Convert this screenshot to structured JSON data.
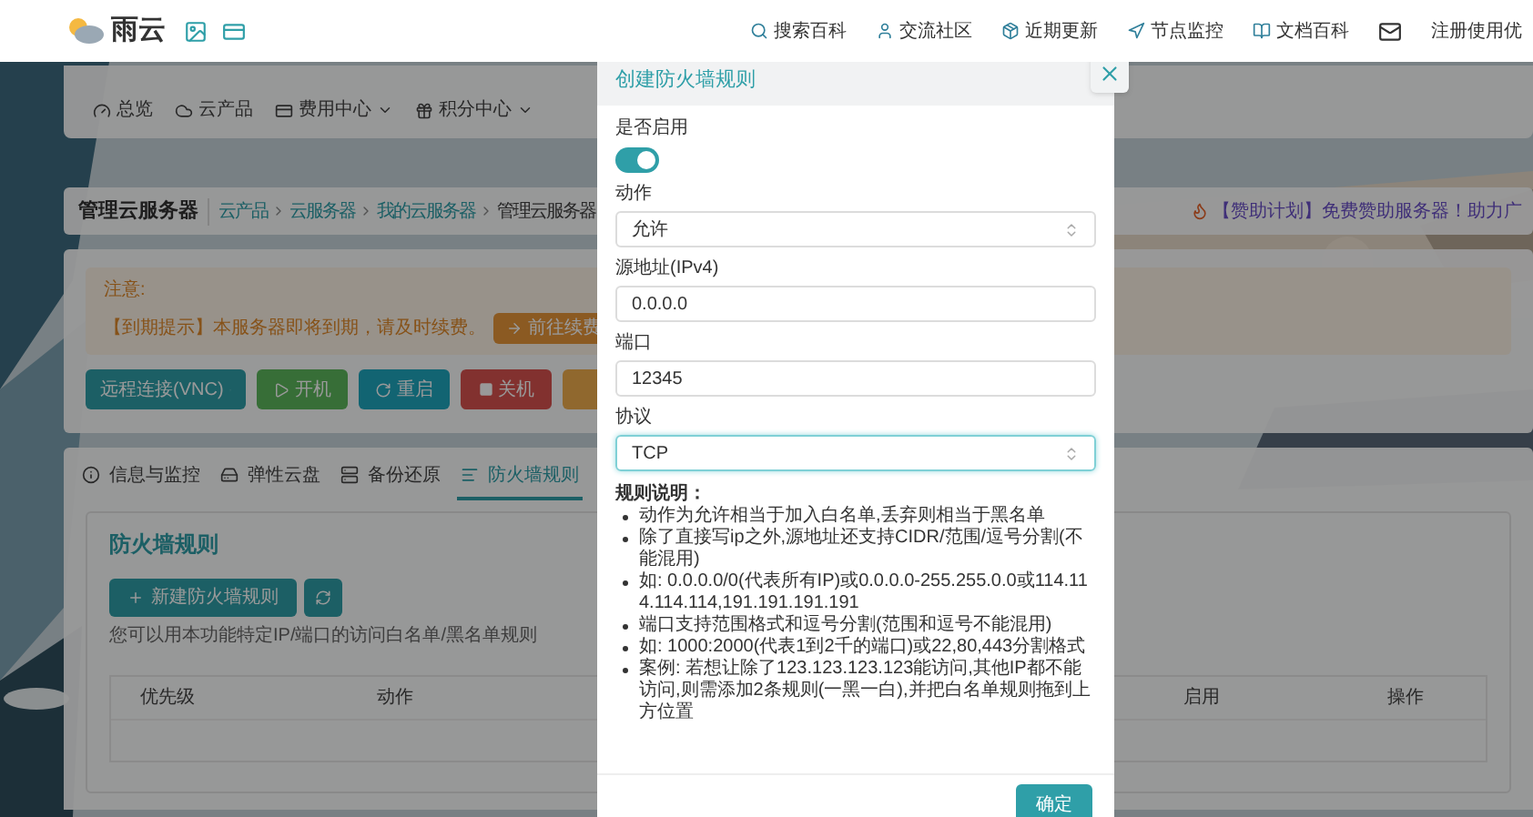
{
  "header": {
    "logo": "雨云",
    "nav": [
      {
        "label": "搜索百科",
        "kind": "search"
      },
      {
        "label": "交流社区",
        "kind": "community"
      },
      {
        "label": "近期更新",
        "kind": "updates"
      },
      {
        "label": "节点监控",
        "kind": "monitor"
      },
      {
        "label": "文档百科",
        "kind": "docs"
      }
    ],
    "cut_label": "注册使用优"
  },
  "main_nav": [
    {
      "label": "总览",
      "kind": "overview",
      "dropdown": false
    },
    {
      "label": "云产品",
      "kind": "products",
      "dropdown": false
    },
    {
      "label": "费用中心",
      "kind": "billing",
      "dropdown": true
    },
    {
      "label": "积分中心",
      "kind": "points",
      "dropdown": true
    }
  ],
  "page_title": "管理云服务器",
  "breadcrumb": [
    "云产品",
    "云服务器",
    "我的云服务器",
    "管理云服务器"
  ],
  "promo": "【赞助计划】免费赞助服务器！助力广",
  "notice": {
    "title": "注意:",
    "message": "【到期提示】本服务器即将到期，请及时续费。",
    "button": "前往续费"
  },
  "actions": [
    {
      "label": "远程连接(VNC)",
      "kind": "vnc"
    },
    {
      "label": "开机",
      "kind": "start"
    },
    {
      "label": "重启",
      "kind": "restart"
    },
    {
      "label": "关机",
      "kind": "stop"
    },
    {
      "kind": "more"
    }
  ],
  "tabs": [
    {
      "label": "信息与监控",
      "kind": "info",
      "selected": false
    },
    {
      "label": "弹性云盘",
      "kind": "disk",
      "selected": false
    },
    {
      "label": "备份还原",
      "kind": "backup",
      "selected": false
    },
    {
      "label": "防火墙规则",
      "kind": "firewall",
      "selected": true
    }
  ],
  "firewall": {
    "title": "防火墙规则",
    "new_button": "新建防火墙规则",
    "description": "您可以用本功能特定IP/端口的访问白名单/黑名单规则",
    "columns": [
      "优先级",
      "动作",
      "启用",
      "操作"
    ]
  },
  "dialog": {
    "title": "创建防火墙规则",
    "enabled_label": "是否启用",
    "enabled": true,
    "fields": [
      {
        "label": "动作",
        "kind": "select",
        "value": "允许",
        "focused": false
      },
      {
        "label": "源地址(IPv4)",
        "kind": "input",
        "value": "0.0.0.0",
        "focused": false
      },
      {
        "label": "端口",
        "kind": "input",
        "value": "12345",
        "focused": false
      },
      {
        "label": "协议",
        "kind": "select",
        "value": "TCP",
        "focused": true
      }
    ],
    "notes_title": "规则说明：",
    "notes": [
      "动作为允许相当于加入白名单,丢弃则相当于黑名单",
      "除了直接写ip之外,源地址还支持CIDR/范围/逗号分割(不能混用)",
      "如: 0.0.0.0/0(代表所有IP)或0.0.0.0-255.255.0.0或114.114.114.114,191.191.191.191",
      "端口支持范围格式和逗号分割(范围和逗号不能混用)",
      "如: 1000:2000(代表1到2千的端口)或22,80,443分割格式",
      "案例: 若想让除了123.123.123.123能访问,其他IP都不能访问,则需添加2条规则(一黑一白),并把白名单规则拖到上方位置"
    ],
    "confirm": "确定"
  }
}
